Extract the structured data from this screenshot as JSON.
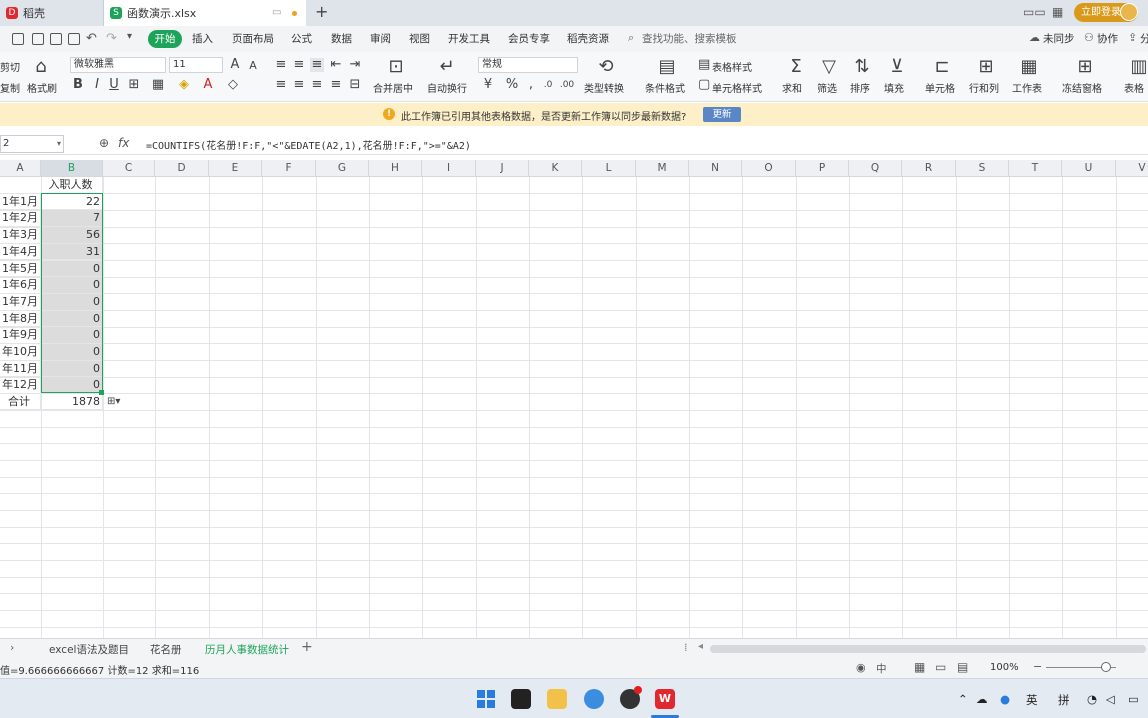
{
  "tabs": [
    {
      "label": "稻壳"
    },
    {
      "label": "函数演示.xlsx"
    }
  ],
  "titlebar": {
    "new_tab": "+",
    "login_label": "立即登录"
  },
  "menu": {
    "start": "开始",
    "items": [
      "插入",
      "页面布局",
      "公式",
      "数据",
      "审阅",
      "视图",
      "开发工具",
      "会员专享",
      "稻壳资源"
    ],
    "search": "查找功能、搜索模板",
    "sync": "未同步",
    "collab": "协作",
    "share": "分"
  },
  "ribbon": {
    "cut_label": "剪切",
    "copy_label": "复制",
    "format_painter": "格式刷",
    "font_name": "微软雅黑",
    "font_size": "11",
    "merge_center": "合并居中",
    "wrap_text": "自动换行",
    "number_format": "常规",
    "type_convert": "类型转换",
    "conditional_format": "条件格式",
    "table_style": "表格样式",
    "cell_style": "单元格样式",
    "sum": "求和",
    "filter": "筛选",
    "sort": "排序",
    "fill": "填充",
    "cell": "单元格",
    "row_col": "行和列",
    "worksheet": "工作表",
    "freeze": "冻结窗格",
    "table_tools": "表格"
  },
  "notification": {
    "message": "此工作簿已引用其他表格数据，是否更新工作簿以同步最新数据?",
    "button": "更新"
  },
  "formula_bar": {
    "name_box": "2",
    "fx": "fx",
    "formula": "=COUNTIFS(花名册!F:F,\"<\"&EDATE(A2,1),花名册!F:F,\">=\"&A2)"
  },
  "grid": {
    "columns": [
      "A",
      "B",
      "C",
      "D",
      "E",
      "F",
      "G",
      "H",
      "I",
      "J",
      "K",
      "L",
      "M",
      "N",
      "O",
      "P",
      "Q",
      "R",
      "S",
      "T",
      "U",
      "V"
    ],
    "header_b": "入职人数",
    "rows": [
      {
        "a": "1年1月",
        "b": "22"
      },
      {
        "a": "1年2月",
        "b": "7"
      },
      {
        "a": "1年3月",
        "b": "56"
      },
      {
        "a": "1年4月",
        "b": "31"
      },
      {
        "a": "1年5月",
        "b": "0"
      },
      {
        "a": "1年6月",
        "b": "0"
      },
      {
        "a": "1年7月",
        "b": "0"
      },
      {
        "a": "1年8月",
        "b": "0"
      },
      {
        "a": "1年9月",
        "b": "0"
      },
      {
        "a": "年10月",
        "b": "0"
      },
      {
        "a": "年11月",
        "b": "0"
      },
      {
        "a": "年12月",
        "b": "0"
      }
    ],
    "total_label": "合计",
    "total_value": "1878"
  },
  "sheets": {
    "tabs": [
      "excel语法及题目",
      "花名册",
      "历月人事数据统计"
    ],
    "active": 2,
    "add": "+"
  },
  "status": {
    "text": "值=9.666666666667 计数=12 求和=116",
    "zoom": "100%",
    "input_mode": "中"
  },
  "taskbar": {
    "lang": "英",
    "ime": "拼"
  },
  "colors": {
    "accent": "#1ea35a",
    "warning_bg": "#fdf0c8",
    "update_btn": "#5a86c8",
    "login_btn": "#d99a1c"
  }
}
